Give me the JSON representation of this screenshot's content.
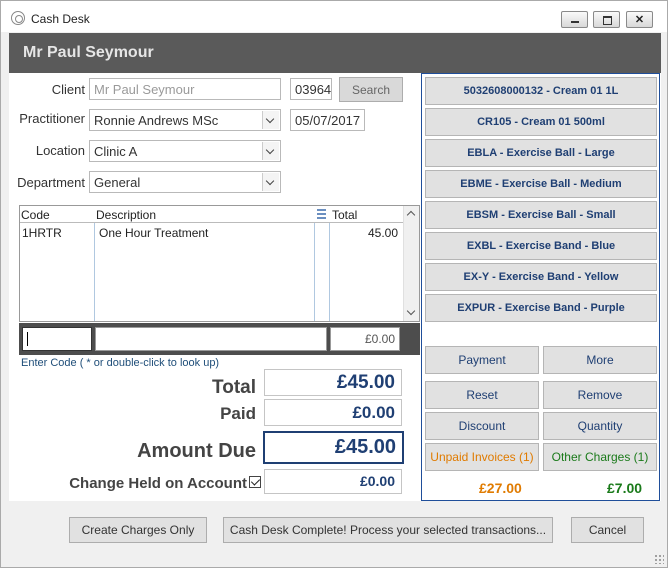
{
  "window": {
    "title": "Cash Desk"
  },
  "header": {
    "name": "Mr Paul Seymour"
  },
  "form": {
    "client_label": "Client",
    "client_value": "Mr Paul Seymour",
    "client_code": "03964",
    "search_label": "Search",
    "practitioner_label": "Practitioner",
    "practitioner_value": "Ronnie Andrews MSc",
    "date_value": "05/07/2017",
    "location_label": "Location",
    "location_value": "Clinic A",
    "department_label": "Department",
    "department_value": "General"
  },
  "grid": {
    "columns": [
      "Code",
      "Description",
      "Total"
    ],
    "rows": [
      {
        "code": "1HRTR",
        "description": "One Hour Treatment",
        "total": "45.00"
      }
    ]
  },
  "entry": {
    "amount": "£0.00",
    "hint": "Enter Code ( * or double-click to look up)"
  },
  "totals": {
    "total_label": "Total",
    "total_value": "£45.00",
    "paid_label": "Paid",
    "paid_value": "£0.00",
    "due_label": "Amount Due",
    "due_value": "£45.00",
    "change_label": "Change Held on Account",
    "change_value": "£0.00"
  },
  "products": [
    "5032608000132 - Cream 01 1L",
    "CR105 - Cream 01 500ml",
    "EBLA - Exercise Ball - Large",
    "EBME - Exercise Ball - Medium",
    "EBSM - Exercise Ball - Small",
    "EXBL - Exercise Band - Blue",
    "EX-Y - Exercise Band - Yellow",
    "EXPUR - Exercise Band - Purple"
  ],
  "actions": {
    "payment": "Payment",
    "more": "More",
    "reset": "Reset",
    "remove": "Remove",
    "discount": "Discount",
    "quantity": "Quantity",
    "unpaid_invoices": "Unpaid Invoices (1)",
    "other_charges": "Other Charges (1)",
    "unpaid_amount": "£27.00",
    "other_amount": "£7.00"
  },
  "footer": {
    "create_charges": "Create Charges Only",
    "complete": "Cash Desk Complete! Process your selected transactions...",
    "cancel": "Cancel"
  },
  "colors": {
    "accent": "#1f3f73",
    "unpaid": "#e07b00",
    "other": "#1a7a1a",
    "header_bg": "#5a5a5a"
  }
}
